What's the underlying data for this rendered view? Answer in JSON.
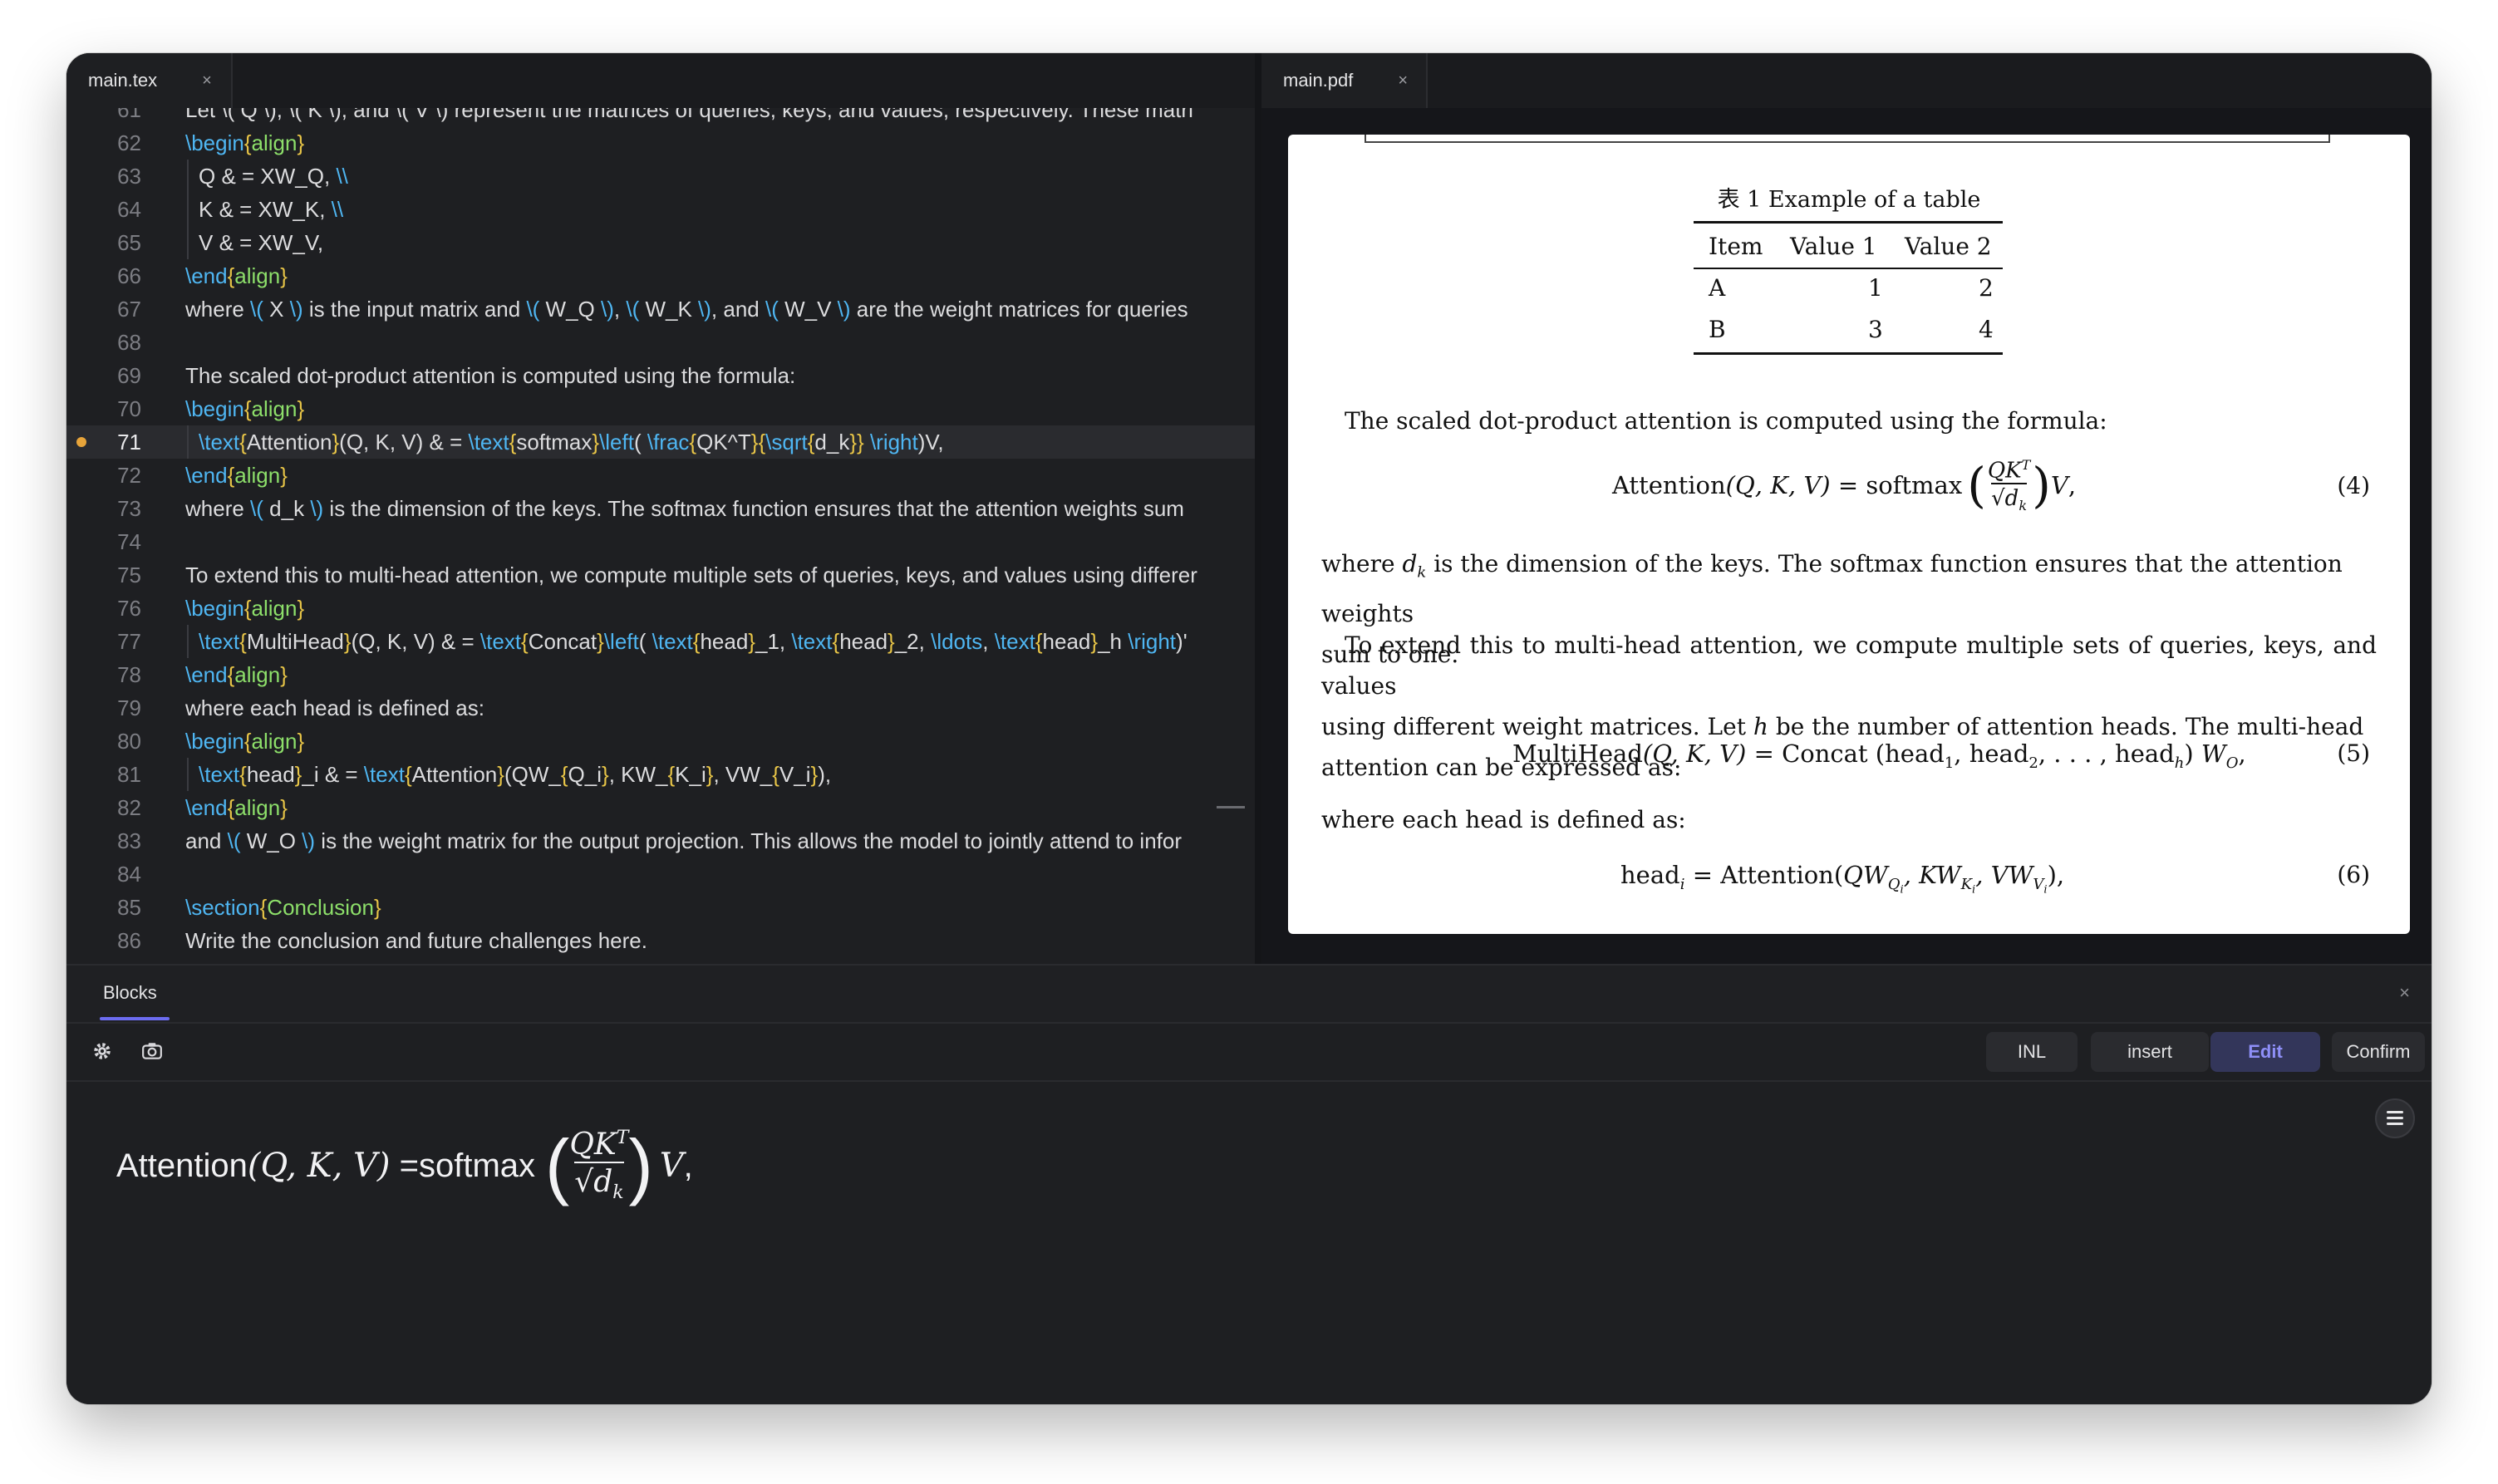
{
  "editor": {
    "tab_label": "main.tex",
    "tab_close": "×",
    "first_line_number": "61",
    "first_line_text": "Let \\( Q \\), \\( K \\), and \\( V \\) represent the matrices of queries, keys, and values, respectively. These matri"
  },
  "pdf": {
    "tab_label": "main.pdf",
    "tab_close": "×",
    "table_caption": "表 1   Example of a table",
    "table": {
      "headers": [
        "Item",
        "Value 1",
        "Value 2"
      ],
      "rows": [
        [
          "A",
          "1",
          "2"
        ],
        [
          "B",
          "3",
          "4"
        ]
      ]
    },
    "para1": "The scaled dot-product attention is computed using the formula:",
    "eq4_num": "(4)",
    "para2a": "where",
    "para2b": "is the dimension of the keys. The softmax function ensures that the attention weights",
    "para2c": "sum to one.",
    "para3a": "To extend this to multi-head attention, we compute multiple sets of queries, keys, and values",
    "para3b": "using different weight matrices.  Let",
    "para3c": "be the number of attention heads.  The multi-head",
    "para3d": "attention can be expressed as:",
    "eq5_num": "(5)",
    "para4": "where each head is defined as:",
    "eq6_num": "(6)"
  },
  "blocks": {
    "tab_label": "Blocks",
    "close": "×",
    "buttons": {
      "inl": "INL",
      "insert": "insert",
      "edit": "Edit",
      "confirm": "Confirm"
    }
  },
  "colors": {
    "accent": "#6c6cf0",
    "keyword": "#4fb6f2",
    "argument": "#8ddf6a",
    "brace": "#e8c547",
    "marker": "#e7a43a"
  },
  "icons": [
    "gear-icon",
    "camera-icon",
    "hamburger-menu-icon",
    "close-icon"
  ]
}
